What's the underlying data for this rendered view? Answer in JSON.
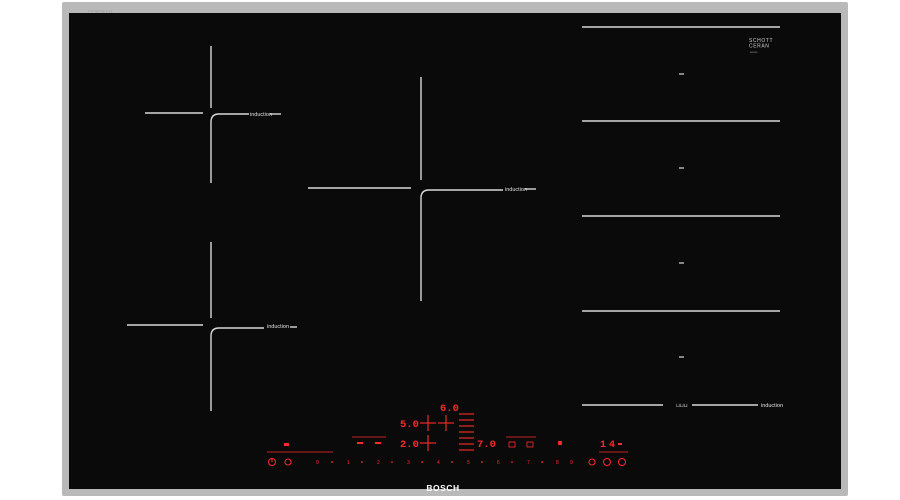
{
  "model_number": "PXV875DC1E",
  "schott_logo": {
    "line1": "SCHOTT",
    "line2": "CERAN",
    "line3": "ceran"
  },
  "zones": [
    {
      "label": "induction"
    },
    {
      "label": "induction"
    },
    {
      "label": "induction"
    },
    {
      "label": "induction"
    }
  ],
  "flex_indicator": "⊔⊔⊔",
  "display": {
    "top_value": "6.0",
    "left_value_1": "5.0",
    "left_value_2": "2.0",
    "center_value": "7.0",
    "right_value": "14"
  },
  "power_scale": [
    "0",
    "1",
    "2",
    "3",
    "4",
    "5",
    "6",
    "7",
    "8",
    "9"
  ],
  "brand": "BOSCH",
  "colors": {
    "glass": "#0a0a0a",
    "frame": "#b9b9b9",
    "line": "#d8d8d8",
    "display": "#ff2a2a"
  }
}
